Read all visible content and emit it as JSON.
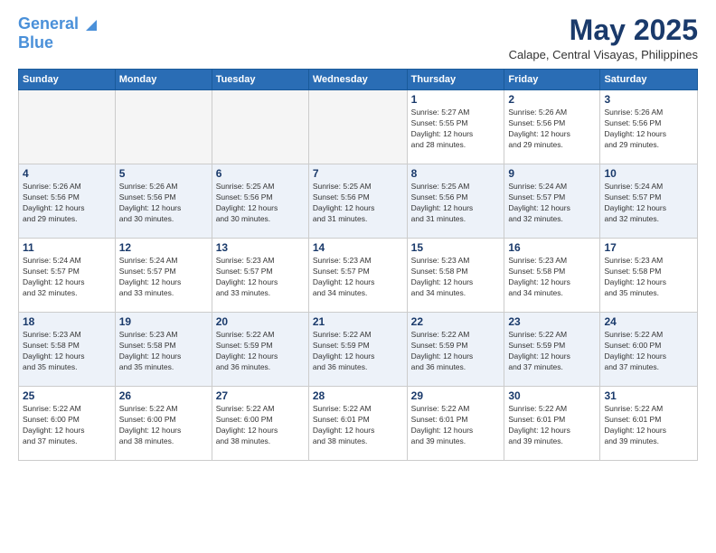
{
  "logo": {
    "line1": "General",
    "line2": "Blue"
  },
  "title": "May 2025",
  "location": "Calape, Central Visayas, Philippines",
  "days_of_week": [
    "Sunday",
    "Monday",
    "Tuesday",
    "Wednesday",
    "Thursday",
    "Friday",
    "Saturday"
  ],
  "weeks": [
    [
      {
        "day": "",
        "info": ""
      },
      {
        "day": "",
        "info": ""
      },
      {
        "day": "",
        "info": ""
      },
      {
        "day": "",
        "info": ""
      },
      {
        "day": "1",
        "info": "Sunrise: 5:27 AM\nSunset: 5:55 PM\nDaylight: 12 hours\nand 28 minutes."
      },
      {
        "day": "2",
        "info": "Sunrise: 5:26 AM\nSunset: 5:56 PM\nDaylight: 12 hours\nand 29 minutes."
      },
      {
        "day": "3",
        "info": "Sunrise: 5:26 AM\nSunset: 5:56 PM\nDaylight: 12 hours\nand 29 minutes."
      }
    ],
    [
      {
        "day": "4",
        "info": "Sunrise: 5:26 AM\nSunset: 5:56 PM\nDaylight: 12 hours\nand 29 minutes."
      },
      {
        "day": "5",
        "info": "Sunrise: 5:26 AM\nSunset: 5:56 PM\nDaylight: 12 hours\nand 30 minutes."
      },
      {
        "day": "6",
        "info": "Sunrise: 5:25 AM\nSunset: 5:56 PM\nDaylight: 12 hours\nand 30 minutes."
      },
      {
        "day": "7",
        "info": "Sunrise: 5:25 AM\nSunset: 5:56 PM\nDaylight: 12 hours\nand 31 minutes."
      },
      {
        "day": "8",
        "info": "Sunrise: 5:25 AM\nSunset: 5:56 PM\nDaylight: 12 hours\nand 31 minutes."
      },
      {
        "day": "9",
        "info": "Sunrise: 5:24 AM\nSunset: 5:57 PM\nDaylight: 12 hours\nand 32 minutes."
      },
      {
        "day": "10",
        "info": "Sunrise: 5:24 AM\nSunset: 5:57 PM\nDaylight: 12 hours\nand 32 minutes."
      }
    ],
    [
      {
        "day": "11",
        "info": "Sunrise: 5:24 AM\nSunset: 5:57 PM\nDaylight: 12 hours\nand 32 minutes."
      },
      {
        "day": "12",
        "info": "Sunrise: 5:24 AM\nSunset: 5:57 PM\nDaylight: 12 hours\nand 33 minutes."
      },
      {
        "day": "13",
        "info": "Sunrise: 5:23 AM\nSunset: 5:57 PM\nDaylight: 12 hours\nand 33 minutes."
      },
      {
        "day": "14",
        "info": "Sunrise: 5:23 AM\nSunset: 5:57 PM\nDaylight: 12 hours\nand 34 minutes."
      },
      {
        "day": "15",
        "info": "Sunrise: 5:23 AM\nSunset: 5:58 PM\nDaylight: 12 hours\nand 34 minutes."
      },
      {
        "day": "16",
        "info": "Sunrise: 5:23 AM\nSunset: 5:58 PM\nDaylight: 12 hours\nand 34 minutes."
      },
      {
        "day": "17",
        "info": "Sunrise: 5:23 AM\nSunset: 5:58 PM\nDaylight: 12 hours\nand 35 minutes."
      }
    ],
    [
      {
        "day": "18",
        "info": "Sunrise: 5:23 AM\nSunset: 5:58 PM\nDaylight: 12 hours\nand 35 minutes."
      },
      {
        "day": "19",
        "info": "Sunrise: 5:23 AM\nSunset: 5:58 PM\nDaylight: 12 hours\nand 35 minutes."
      },
      {
        "day": "20",
        "info": "Sunrise: 5:22 AM\nSunset: 5:59 PM\nDaylight: 12 hours\nand 36 minutes."
      },
      {
        "day": "21",
        "info": "Sunrise: 5:22 AM\nSunset: 5:59 PM\nDaylight: 12 hours\nand 36 minutes."
      },
      {
        "day": "22",
        "info": "Sunrise: 5:22 AM\nSunset: 5:59 PM\nDaylight: 12 hours\nand 36 minutes."
      },
      {
        "day": "23",
        "info": "Sunrise: 5:22 AM\nSunset: 5:59 PM\nDaylight: 12 hours\nand 37 minutes."
      },
      {
        "day": "24",
        "info": "Sunrise: 5:22 AM\nSunset: 6:00 PM\nDaylight: 12 hours\nand 37 minutes."
      }
    ],
    [
      {
        "day": "25",
        "info": "Sunrise: 5:22 AM\nSunset: 6:00 PM\nDaylight: 12 hours\nand 37 minutes."
      },
      {
        "day": "26",
        "info": "Sunrise: 5:22 AM\nSunset: 6:00 PM\nDaylight: 12 hours\nand 38 minutes."
      },
      {
        "day": "27",
        "info": "Sunrise: 5:22 AM\nSunset: 6:00 PM\nDaylight: 12 hours\nand 38 minutes."
      },
      {
        "day": "28",
        "info": "Sunrise: 5:22 AM\nSunset: 6:01 PM\nDaylight: 12 hours\nand 38 minutes."
      },
      {
        "day": "29",
        "info": "Sunrise: 5:22 AM\nSunset: 6:01 PM\nDaylight: 12 hours\nand 39 minutes."
      },
      {
        "day": "30",
        "info": "Sunrise: 5:22 AM\nSunset: 6:01 PM\nDaylight: 12 hours\nand 39 minutes."
      },
      {
        "day": "31",
        "info": "Sunrise: 5:22 AM\nSunset: 6:01 PM\nDaylight: 12 hours\nand 39 minutes."
      }
    ]
  ]
}
